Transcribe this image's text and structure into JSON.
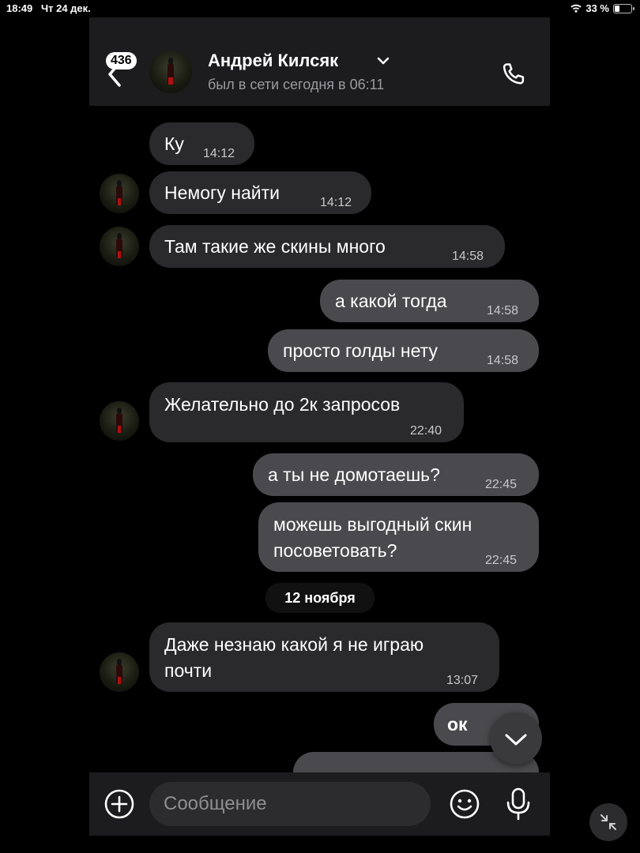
{
  "status_bar": {
    "time": "18:49",
    "date": "Чт 24 дек.",
    "battery": "33 %"
  },
  "header": {
    "unread_badge": "436",
    "contact_name": "Андрей Килсяк",
    "last_seen": "был в сети сегодня в 06:11"
  },
  "messages": [
    {
      "dir": "in",
      "text": "Ку",
      "time": "14:12"
    },
    {
      "dir": "in",
      "text": "Немогу найти",
      "time": "14:12"
    },
    {
      "dir": "in",
      "text": "Там такие же скины много",
      "time": "14:58"
    },
    {
      "dir": "out",
      "text": "а какой тогда",
      "time": "14:58"
    },
    {
      "dir": "out",
      "text": "просто голды нету",
      "time": "14:58"
    },
    {
      "dir": "in",
      "text": "Желательно до 2к запросов",
      "time": "22:40"
    },
    {
      "dir": "out",
      "text": "а ты не домотаешь?",
      "time": "22:45"
    },
    {
      "dir": "out",
      "line1": "можешь выгодный скин",
      "line2": "посоветовать?",
      "time": "22:45"
    },
    {
      "dir": "in",
      "line1": "Даже незнаю какой я не играю",
      "line2": "почти",
      "time": "13:07"
    },
    {
      "dir": "out",
      "text": "ок"
    }
  ],
  "date_separator": "12 ноября",
  "composer": {
    "placeholder": "Сообщение"
  },
  "icons": {
    "back": "chevron-left-icon",
    "dropdown": "chevron-down-icon",
    "call": "phone-icon",
    "attach": "plus-circle-icon",
    "emoji": "smiley-icon",
    "voice": "microphone-icon",
    "scroll": "chevron-down-icon",
    "collapse": "collapse-arrows-icon"
  },
  "colors": {
    "incoming_bubble": "#2a2a2d",
    "outgoing_bubble": "#4a4a4e",
    "panel": "#1c1c1e"
  }
}
